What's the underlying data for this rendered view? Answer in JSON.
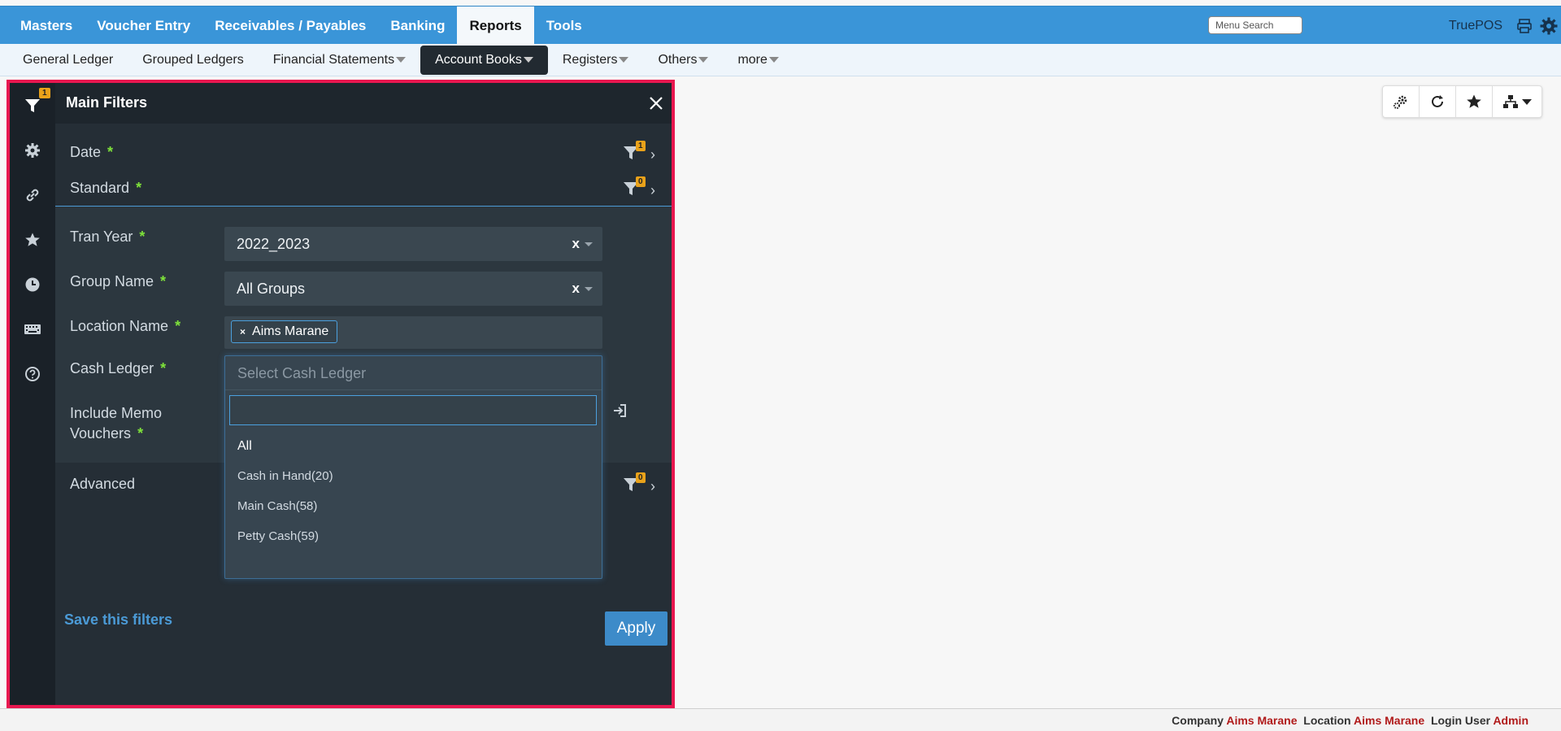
{
  "topnav": {
    "items": [
      "Masters",
      "Voucher Entry",
      "Receivables / Payables",
      "Banking",
      "Reports",
      "Tools"
    ],
    "active": "Reports",
    "menu_search": "Menu Search",
    "brand": "TruePOS"
  },
  "subnav": {
    "items": [
      {
        "label": "General Ledger",
        "dropdown": false
      },
      {
        "label": "Grouped Ledgers",
        "dropdown": false
      },
      {
        "label": "Financial Statements",
        "dropdown": true
      },
      {
        "label": "Account Books",
        "dropdown": true
      },
      {
        "label": "Registers",
        "dropdown": true
      },
      {
        "label": "Others",
        "dropdown": true
      },
      {
        "label": "more",
        "dropdown": true
      }
    ],
    "active": "Account Books"
  },
  "panel": {
    "title": "Main Filters",
    "rail_badge": "1",
    "sections": {
      "date": {
        "label": "Date",
        "count": "1"
      },
      "standard": {
        "label": "Standard",
        "count": "0"
      },
      "advanced": {
        "label": "Advanced",
        "count": "0"
      }
    },
    "fields": {
      "tran_year": {
        "label": "Tran Year",
        "value": "2022_2023",
        "clear": "x"
      },
      "group_name": {
        "label": "Group Name",
        "value": "All Groups",
        "clear": "x"
      },
      "location_name": {
        "label": "Location Name",
        "tag": "Aims Marane",
        "tag_remove": "×"
      },
      "cash_ledger": {
        "label": "Cash Ledger",
        "placeholder": "Select Cash Ledger"
      },
      "memo": {
        "label_line1": "Include Memo",
        "label_line2": "Vouchers"
      }
    },
    "required_mark": "*",
    "dropdown_options": [
      "All",
      "Cash in Hand(20)",
      "Main Cash(58)",
      "Petty Cash(59)"
    ],
    "save_link": "Save this filters",
    "apply": "Apply"
  },
  "footer": {
    "company_label": "Company",
    "company_value": "Aims Marane",
    "location_label": "Location",
    "location_value": "Aims Marane",
    "user_label": "Login User",
    "user_value": "Admin"
  },
  "colors": {
    "nav_blue": "#3a95d8",
    "panel_border": "#e8174f",
    "panel_bg": "#252e36",
    "required": "#7ee23a",
    "badge": "#e9a21a"
  }
}
